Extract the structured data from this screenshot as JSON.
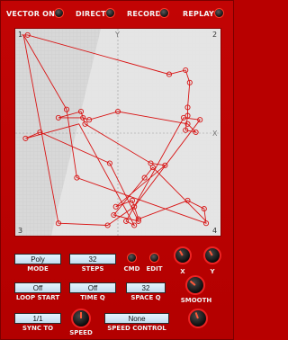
{
  "header": {
    "vector_on": "VECTOR ON",
    "direct": "DIRECT",
    "record": "RECORD",
    "replay": "REPLAY"
  },
  "corners": {
    "c1": "1",
    "c2": "2",
    "c3": "3",
    "c4": "4"
  },
  "axis_marks": {
    "y": "Y",
    "x": "X"
  },
  "controls": {
    "mode": {
      "value": "Poly",
      "label": "MODE"
    },
    "steps": {
      "value": "32",
      "label": "STEPS"
    },
    "cmd": "CMD",
    "edit": "EDIT",
    "knob_x": "X",
    "knob_y": "Y",
    "loop_start": {
      "value": "Off",
      "label": "LOOP START"
    },
    "time_q": {
      "value": "Off",
      "label": "TIME Q"
    },
    "space_q": {
      "value": "32",
      "label": "SPACE Q"
    },
    "smooth": "SMOOTH",
    "sync_to": {
      "value": "1/1",
      "label": "SYNC TO"
    },
    "speed": "SPEED",
    "speed_control": {
      "value": "None",
      "label": "SPEED CONTROL"
    }
  },
  "colors": {
    "panel": "#c00000",
    "trace": "#d81414",
    "led_ring": "#ff3a2a",
    "lcd": "#d4e9f7"
  },
  "path_points": [
    [
      0.03,
      0.03
    ],
    [
      0.06,
      0.03
    ],
    [
      0.75,
      0.22
    ],
    [
      0.83,
      0.2
    ],
    [
      0.85,
      0.26
    ],
    [
      0.84,
      0.38
    ],
    [
      0.84,
      0.42
    ],
    [
      0.83,
      0.49
    ],
    [
      0.88,
      0.5
    ],
    [
      0.84,
      0.46
    ],
    [
      0.5,
      0.4
    ],
    [
      0.36,
      0.44
    ],
    [
      0.33,
      0.43
    ],
    [
      0.21,
      0.43
    ],
    [
      0.32,
      0.4
    ],
    [
      0.34,
      0.46
    ],
    [
      0.66,
      0.65
    ],
    [
      0.73,
      0.66
    ],
    [
      0.49,
      0.86
    ],
    [
      0.57,
      0.83
    ],
    [
      0.6,
      0.92
    ],
    [
      0.84,
      0.83
    ],
    [
      0.92,
      0.87
    ],
    [
      0.93,
      0.94
    ],
    [
      0.3,
      0.72
    ],
    [
      0.25,
      0.39
    ],
    [
      0.04,
      0.03
    ],
    [
      0.21,
      0.94
    ],
    [
      0.45,
      0.95
    ],
    [
      0.58,
      0.86
    ],
    [
      0.9,
      0.44
    ],
    [
      0.82,
      0.43
    ],
    [
      0.54,
      0.93
    ],
    [
      0.58,
      0.95
    ],
    [
      0.31,
      0.46
    ],
    [
      0.05,
      0.53
    ],
    [
      0.12,
      0.5
    ],
    [
      0.46,
      0.65
    ],
    [
      0.6,
      0.93
    ],
    [
      0.48,
      0.9
    ],
    [
      0.63,
      0.72
    ],
    [
      0.67,
      0.67
    ],
    [
      0.93,
      0.93
    ]
  ],
  "dot_indices": [
    1,
    2,
    3,
    4,
    5,
    6,
    7,
    8,
    9,
    10,
    11,
    12,
    13,
    14,
    15,
    16,
    17,
    18,
    19,
    20,
    21,
    22,
    23,
    24,
    25,
    27,
    28,
    29,
    30,
    31,
    32,
    33,
    35,
    36,
    37,
    38,
    39,
    40,
    41
  ]
}
